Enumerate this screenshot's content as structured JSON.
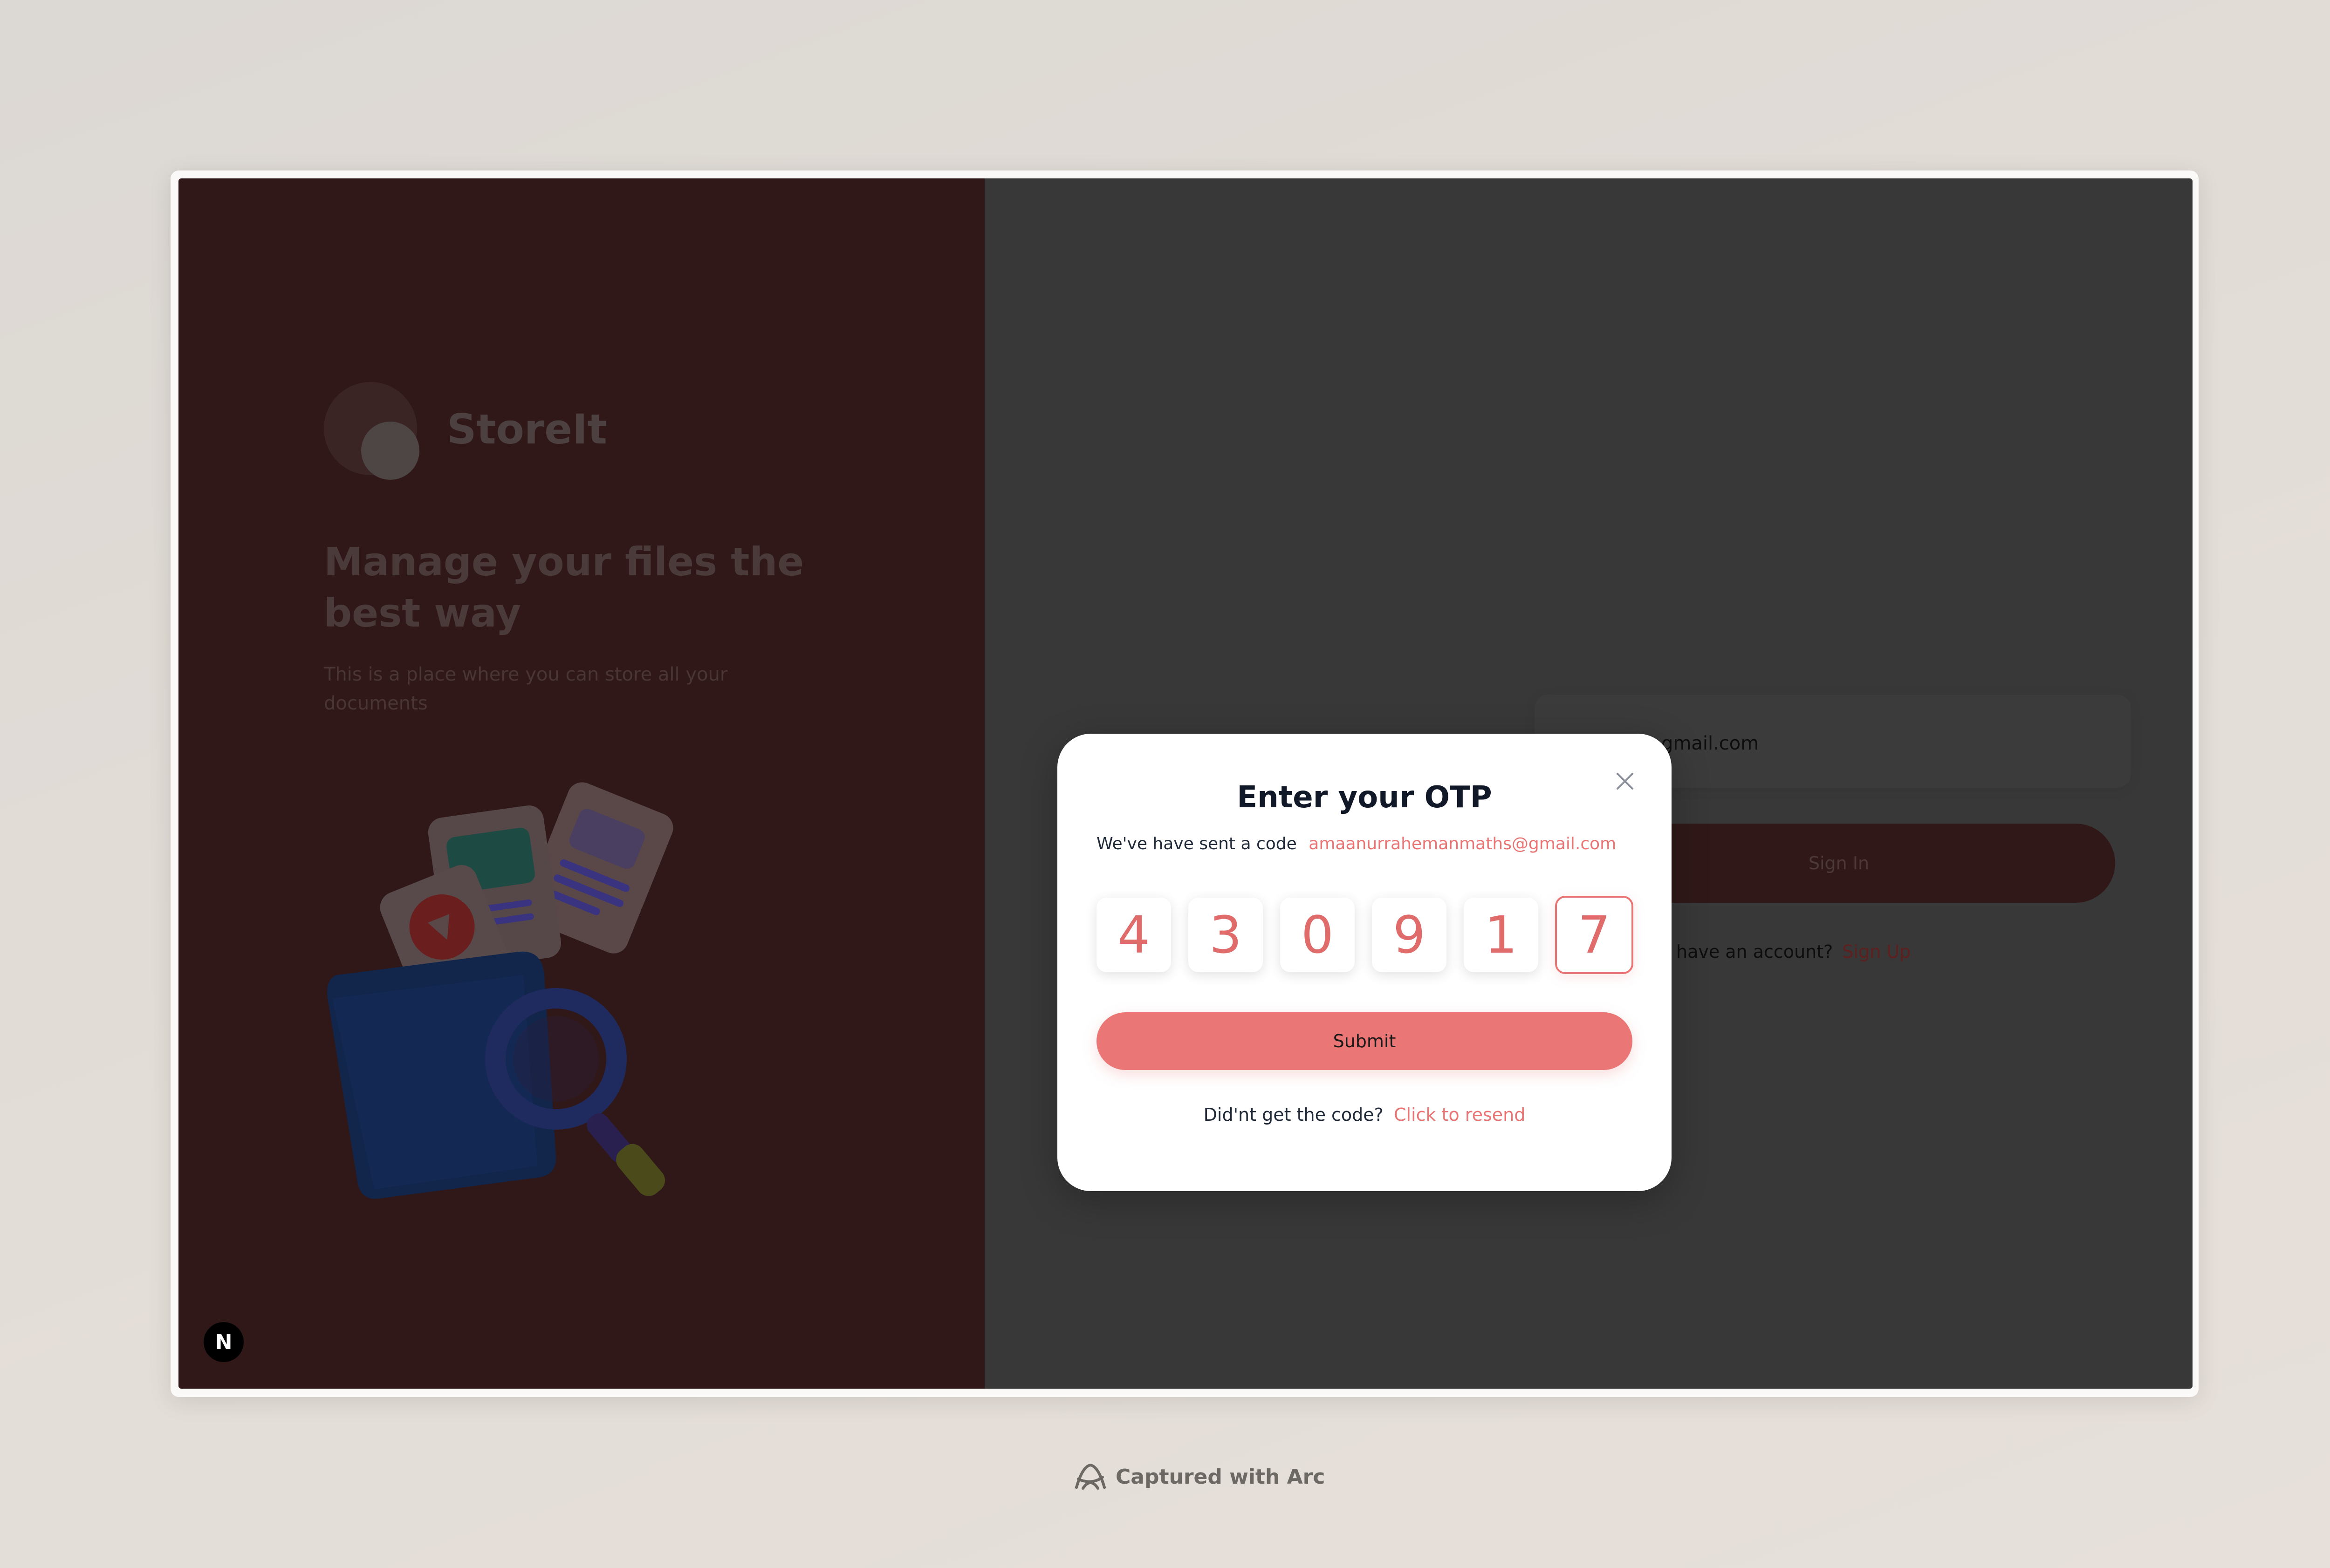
{
  "brand": {
    "name": "StoreIt",
    "headline": "Manage your files the best way",
    "subtext": "This is a place where you can store all your documents"
  },
  "form": {
    "email_partial": "gmail.com",
    "signin_label": "Sign In",
    "account_prompt": "t have an account?",
    "signup_label": "Sign Up"
  },
  "otp_modal": {
    "title": "Enter your OTP",
    "subtitle": "We've have sent a code",
    "email": "amaanurrahemanmaths@gmail.com",
    "digits": [
      "4",
      "3",
      "0",
      "9",
      "1",
      "7"
    ],
    "submit_label": "Submit",
    "resend_prompt": "Did'nt get the code?",
    "resend_link": "Click to resend"
  },
  "badge": {
    "letter": "N"
  },
  "footer": {
    "caption": "Captured with Arc"
  },
  "colors": {
    "accent": "#EA7676",
    "brand_panel": "#301818",
    "overlay_panel": "#383838",
    "background": "#DDD8D3"
  },
  "icons": [
    "close-icon",
    "storeit-logo",
    "files-folder-illustration",
    "nextjs-badge",
    "arc-logo-icon"
  ]
}
